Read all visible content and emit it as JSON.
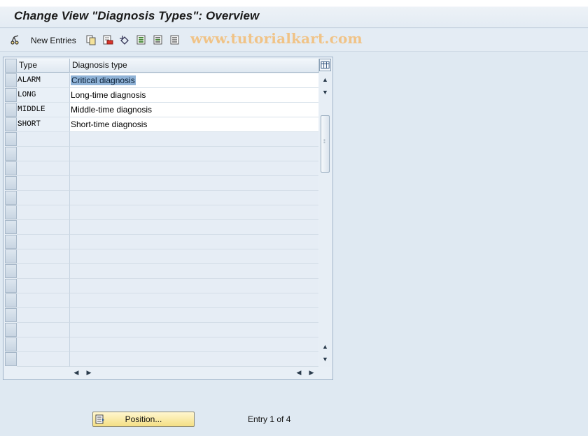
{
  "title": "Change View \"Diagnosis Types\": Overview",
  "toolbar": {
    "new_entries_label": "New Entries",
    "watermark": "www.tutorialkart.com",
    "icons": [
      "glasses-icon",
      "copy-icon",
      "delete-icon",
      "undo-icon",
      "select-all-icon",
      "select-block-icon",
      "deselect-all-icon"
    ]
  },
  "table": {
    "headers": {
      "type": "Type",
      "description": "Diagnosis type"
    },
    "rows": [
      {
        "type": "ALARM",
        "description": "Critical diagnosis",
        "selected": true
      },
      {
        "type": "LONG",
        "description": "Long-time diagnosis"
      },
      {
        "type": "MIDDLE",
        "description": "Middle-time diagnosis"
      },
      {
        "type": "SHORT",
        "description": "Short-time diagnosis"
      }
    ],
    "visible_row_count": 20
  },
  "footer": {
    "position_button_label": "Position...",
    "entry_status": "Entry 1 of 4"
  },
  "colors": {
    "button_yellow": "#f4df84",
    "highlight": "#8fb2d6",
    "background": "#dfe9f2"
  }
}
